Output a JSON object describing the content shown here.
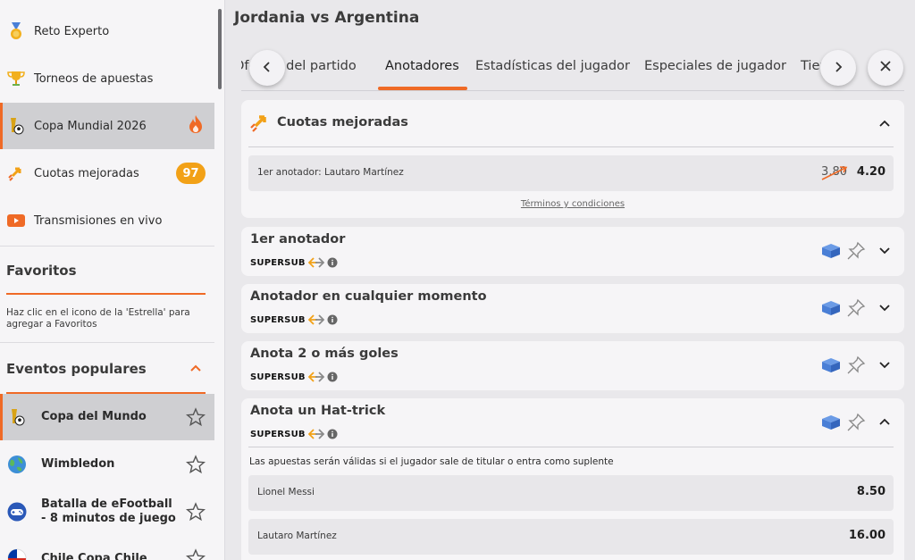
{
  "sidebar": {
    "items": [
      {
        "label": "Reto Experto",
        "icon": "medal-icon"
      },
      {
        "label": "Torneos de apuestas",
        "icon": "trophy-icon"
      },
      {
        "label": "Copa Mundial 2026",
        "icon": "world-cup-icon",
        "active": true
      },
      {
        "label": "Cuotas mejoradas",
        "icon": "boosted-odds-icon",
        "badge": "97"
      },
      {
        "label": "Transmisiones en vivo",
        "icon": "live-stream-icon"
      }
    ],
    "favorites": {
      "title": "Favoritos",
      "note": "Haz clic en el icono de la 'Estrella' para agregar a Favoritos"
    },
    "popular": {
      "title": "Eventos populares",
      "events": [
        {
          "label": "Copa del Mundo",
          "icon": "world-cup-icon"
        },
        {
          "label": "Wimbledon",
          "icon": "globe-icon"
        },
        {
          "label": "Batalla de eFootball - 8 minutos de juego",
          "icon": "gamepad-icon"
        },
        {
          "label": "Chile Copa Chile",
          "icon": "chile-flag-icon"
        }
      ]
    }
  },
  "main": {
    "title": "Jordania vs Argentina",
    "tabs": [
      "Ofertas del partido",
      "Anotadores",
      "Estadísticas del jugador",
      "Especiales de jugador",
      "Tiempo"
    ],
    "active_tab": "Anotadores",
    "boosted": {
      "title": "Cuotas mejoradas",
      "row": {
        "name": "1er anotador: Lautaro Martínez",
        "old": "3.80",
        "new": "4.20"
      },
      "terms": "Términos y condiciones"
    },
    "supersub_label": "SUPERSUB",
    "markets": [
      {
        "title": "1er anotador"
      },
      {
        "title": "Anotador en cualquier momento"
      },
      {
        "title": "Anota 2 o más goles"
      },
      {
        "title": "Anota un Hat-trick"
      }
    ],
    "hattrick": {
      "note": "Las apuestas serán válidas si el jugador sale de titular o entra como suplente",
      "rows": [
        {
          "name": "Lionel Messi",
          "odds": "8.50"
        },
        {
          "name": "Lautaro Martínez",
          "odds": "16.00"
        }
      ]
    }
  },
  "colors": {
    "accent": "#ef6a26",
    "badge": "#f2a117",
    "builder": "#4a7fd6"
  }
}
